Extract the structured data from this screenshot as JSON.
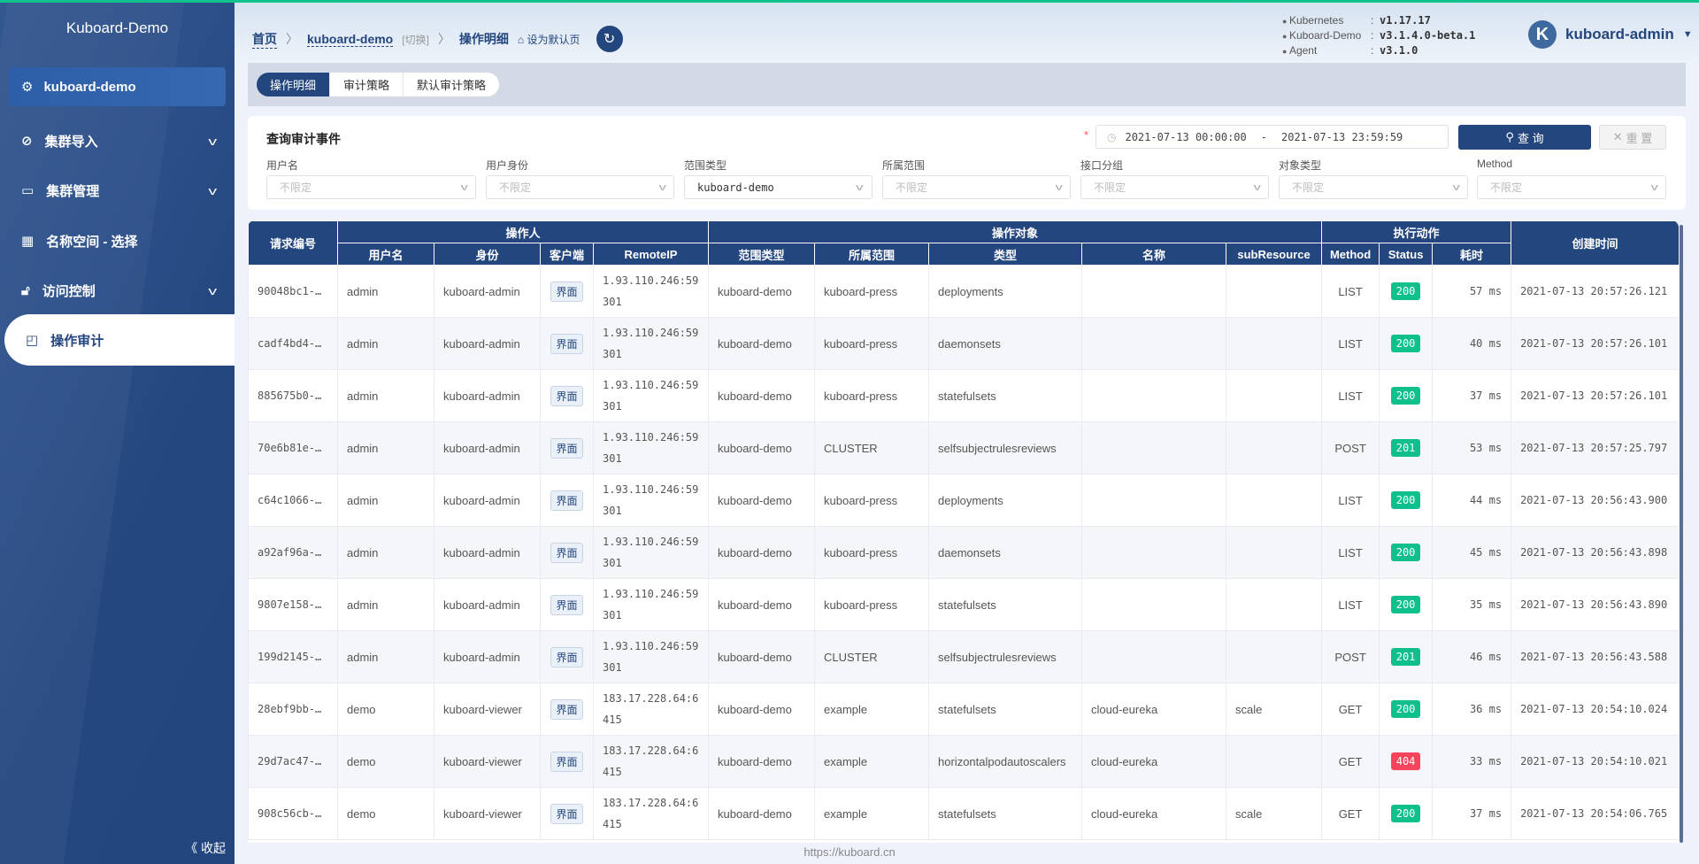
{
  "colors": {
    "primary": "#24467f",
    "accent": "#12c28d",
    "status_ok": "#0fbf8c",
    "status_err": "#f5455c"
  },
  "sidebar": {
    "title": "Kuboard-Demo",
    "cluster": "kuboard-demo",
    "items": [
      {
        "label": "集群导入",
        "icon": "link-icon",
        "expandable": true
      },
      {
        "label": "集群管理",
        "icon": "archive-icon",
        "expandable": true
      },
      {
        "label": "名称空间 - 选择",
        "icon": "grid-icon",
        "expandable": false
      },
      {
        "label": "访问控制",
        "icon": "lock-icon",
        "expandable": true
      },
      {
        "label": "操作审计",
        "icon": "audit-icon",
        "expandable": false,
        "active": true
      }
    ],
    "collapse": "《 收起"
  },
  "header": {
    "breadcrumb": {
      "home": "首页",
      "cluster": "kuboard-demo",
      "switch": "[切换]",
      "current": "操作明细",
      "set_default": "设为默认页"
    },
    "versions": [
      {
        "name": "Kubernetes",
        "value": "v1.17.17"
      },
      {
        "name": "Kuboard-Demo",
        "value": "v3.1.4.0-beta.1"
      },
      {
        "name": "Agent",
        "value": "v3.1.0"
      }
    ],
    "avatar_letter": "K",
    "user": "kuboard-admin"
  },
  "tabs": [
    "操作明细",
    "审计策略",
    "默认审计策略"
  ],
  "query": {
    "title": "查询审计事件",
    "date_start": "2021-07-13 00:00:00",
    "date_sep": "-",
    "date_end": "2021-07-13 23:59:59",
    "search_label": "查 询",
    "reset_label": "重 置",
    "filters": [
      {
        "label": "用户名",
        "value": "不限定",
        "placeholder": true
      },
      {
        "label": "用户身份",
        "value": "不限定",
        "placeholder": true
      },
      {
        "label": "范围类型",
        "value": "kuboard-demo",
        "placeholder": false
      },
      {
        "label": "所属范围",
        "value": "不限定",
        "placeholder": true
      },
      {
        "label": "接口分组",
        "value": "不限定",
        "placeholder": true
      },
      {
        "label": "对象类型",
        "value": "不限定",
        "placeholder": true
      },
      {
        "label": "Method",
        "value": "不限定",
        "placeholder": true
      }
    ]
  },
  "table": {
    "groups": {
      "id": "请求编号",
      "operator": "操作人",
      "target": "操作对象",
      "action": "执行动作",
      "created": "创建时间"
    },
    "columns": [
      "用户名",
      "身份",
      "客户端",
      "RemoteIP",
      "范围类型",
      "所属范围",
      "类型",
      "名称",
      "subResource",
      "Method",
      "Status",
      "耗时"
    ],
    "rows": [
      [
        "90048bc1-…",
        "admin",
        "kuboard-admin",
        "界面",
        "1.93.110.246:59301",
        "kuboard-demo",
        "kuboard-press",
        "deployments",
        "",
        "",
        "LIST",
        "200",
        "57 ms",
        "2021-07-13 20:57:26.121"
      ],
      [
        "cadf4bd4-…",
        "admin",
        "kuboard-admin",
        "界面",
        "1.93.110.246:59301",
        "kuboard-demo",
        "kuboard-press",
        "daemonsets",
        "",
        "",
        "LIST",
        "200",
        "40 ms",
        "2021-07-13 20:57:26.101"
      ],
      [
        "885675b0-…",
        "admin",
        "kuboard-admin",
        "界面",
        "1.93.110.246:59301",
        "kuboard-demo",
        "kuboard-press",
        "statefulsets",
        "",
        "",
        "LIST",
        "200",
        "37 ms",
        "2021-07-13 20:57:26.101"
      ],
      [
        "70e6b81e-…",
        "admin",
        "kuboard-admin",
        "界面",
        "1.93.110.246:59301",
        "kuboard-demo",
        "CLUSTER",
        "selfsubjectrulesreviews",
        "",
        "",
        "POST",
        "201",
        "53 ms",
        "2021-07-13 20:57:25.797"
      ],
      [
        "c64c1066-…",
        "admin",
        "kuboard-admin",
        "界面",
        "1.93.110.246:59301",
        "kuboard-demo",
        "kuboard-press",
        "deployments",
        "",
        "",
        "LIST",
        "200",
        "44 ms",
        "2021-07-13 20:56:43.900"
      ],
      [
        "a92af96a-…",
        "admin",
        "kuboard-admin",
        "界面",
        "1.93.110.246:59301",
        "kuboard-demo",
        "kuboard-press",
        "daemonsets",
        "",
        "",
        "LIST",
        "200",
        "45 ms",
        "2021-07-13 20:56:43.898"
      ],
      [
        "9807e158-…",
        "admin",
        "kuboard-admin",
        "界面",
        "1.93.110.246:59301",
        "kuboard-demo",
        "kuboard-press",
        "statefulsets",
        "",
        "",
        "LIST",
        "200",
        "35 ms",
        "2021-07-13 20:56:43.890"
      ],
      [
        "199d2145-…",
        "admin",
        "kuboard-admin",
        "界面",
        "1.93.110.246:59301",
        "kuboard-demo",
        "CLUSTER",
        "selfsubjectrulesreviews",
        "",
        "",
        "POST",
        "201",
        "46 ms",
        "2021-07-13 20:56:43.588"
      ],
      [
        "28ebf9bb-…",
        "demo",
        "kuboard-viewer",
        "界面",
        "183.17.228.64:6415",
        "kuboard-demo",
        "example",
        "statefulsets",
        "cloud-eureka",
        "scale",
        "GET",
        "200",
        "36 ms",
        "2021-07-13 20:54:10.024"
      ],
      [
        "29d7ac47-…",
        "demo",
        "kuboard-viewer",
        "界面",
        "183.17.228.64:6415",
        "kuboard-demo",
        "example",
        "horizontalpodautoscalers",
        "cloud-eureka",
        "",
        "GET",
        "404",
        "33 ms",
        "2021-07-13 20:54:10.021"
      ],
      [
        "908c56cb-…",
        "demo",
        "kuboard-viewer",
        "界面",
        "183.17.228.64:6415",
        "kuboard-demo",
        "example",
        "statefulsets",
        "cloud-eureka",
        "scale",
        "GET",
        "200",
        "37 ms",
        "2021-07-13 20:54:06.765"
      ]
    ]
  },
  "footer": "https://kuboard.cn"
}
